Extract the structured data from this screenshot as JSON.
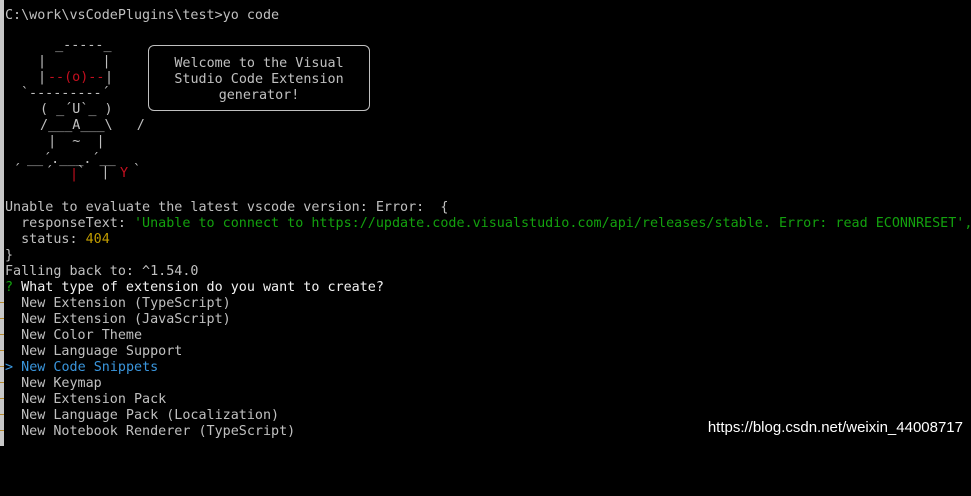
{
  "terminal": {
    "command_line": "C:\\work\\vsCodePlugins\\test>yo code",
    "welcome_text": "Welcome to the Visual\nStudio Code Extension\ngenerator!",
    "error_line": "Unable to evaluate the latest vscode version: Error:  {",
    "response_key": "  responseText: ",
    "response_value": "'Unable to connect to https://update.code.visualstudio.com/api/releases/stable. Error: read ECONNRESET',",
    "status_key": "  status: ",
    "status_value": "404",
    "close_brace": "}",
    "fallback_line": "Falling back to: ^1.54.0",
    "question_mark": "?",
    "question_text": " What type of extension do you want to create?",
    "options": [
      {
        "label": "  New Extension (TypeScript)",
        "selected": false
      },
      {
        "label": "  New Extension (JavaScript)",
        "selected": false
      },
      {
        "label": "  New Color Theme",
        "selected": false
      },
      {
        "label": "  New Language Support",
        "selected": false
      },
      {
        "label": "  New Code Snippets",
        "selected": true
      },
      {
        "label": "  New Keymap",
        "selected": false
      },
      {
        "label": "  New Extension Pack",
        "selected": false
      },
      {
        "label": "  New Language Pack (Localization)",
        "selected": false
      },
      {
        "label": "  New Notebook Renderer (TypeScript)",
        "selected": false
      }
    ],
    "selection_pointer": ">"
  },
  "ascii_art": {
    "hat_top": "  _-----_",
    "hat_band_l": " |       |",
    "face_l": " |",
    "face_m": "--(o)--",
    "face_r": "|",
    "brim": "`---------´",
    "mouth": " ( _´U`_ )",
    "body": " /___A___\\   /",
    "legs": "  |  ~  |",
    "feet_l": "__´.___.´__",
    "feet_r": "´   `  |",
    "foot_mark_red": "|",
    "foot_mark_y": "Y",
    "foot_left_tick": "´",
    "foot_right_tick": "`"
  },
  "watermark": {
    "text": "https://blog.csdn.net/weixin_44008717"
  },
  "colors": {
    "background": "#000000",
    "text": "#c0c0c0",
    "string_green": "#13a10e",
    "number_olive": "#c19c00",
    "selected_cyan": "#3a96dd",
    "red": "#c50f1f"
  }
}
